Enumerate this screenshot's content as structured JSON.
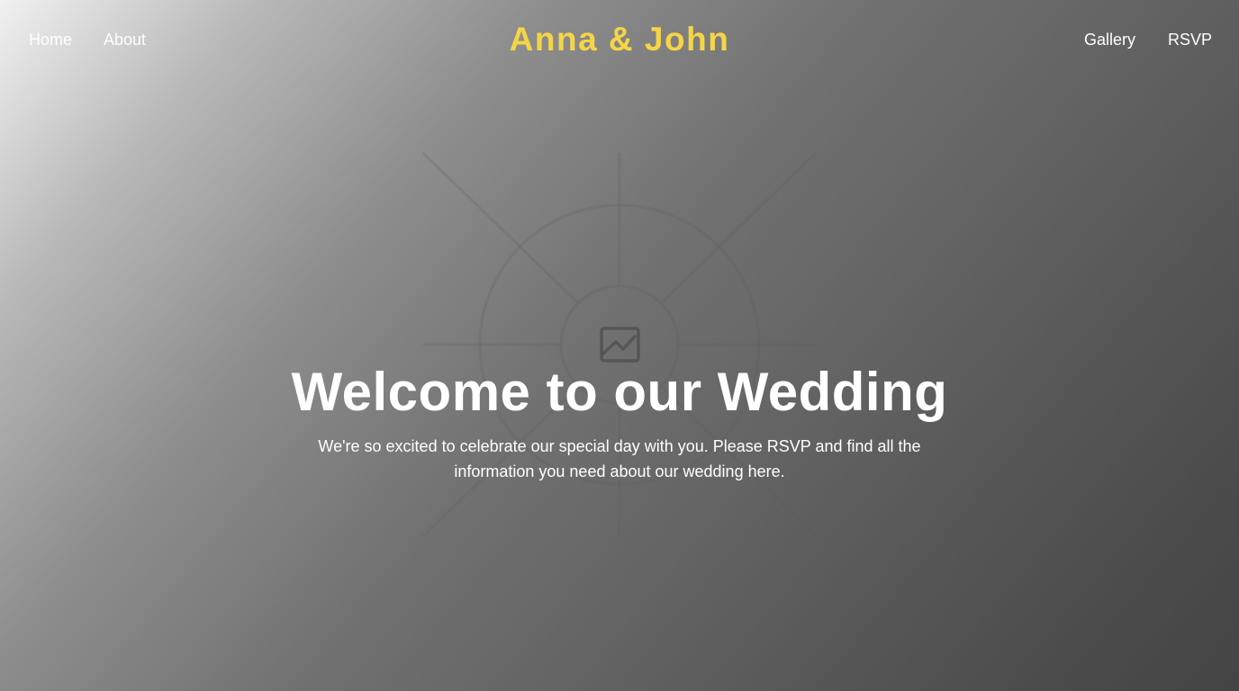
{
  "nav": {
    "home": "Home",
    "about": "About",
    "gallery": "Gallery",
    "rsvp": "RSVP"
  },
  "brand": {
    "name": "Anna & John",
    "color": "#f5d547"
  },
  "hero": {
    "title": "Welcome to our Wedding",
    "subtitle": "We're so excited to celebrate our special day with you. Please RSVP and find all the information you need about our wedding here.",
    "placeholder_icon": "image-placeholder-icon"
  }
}
